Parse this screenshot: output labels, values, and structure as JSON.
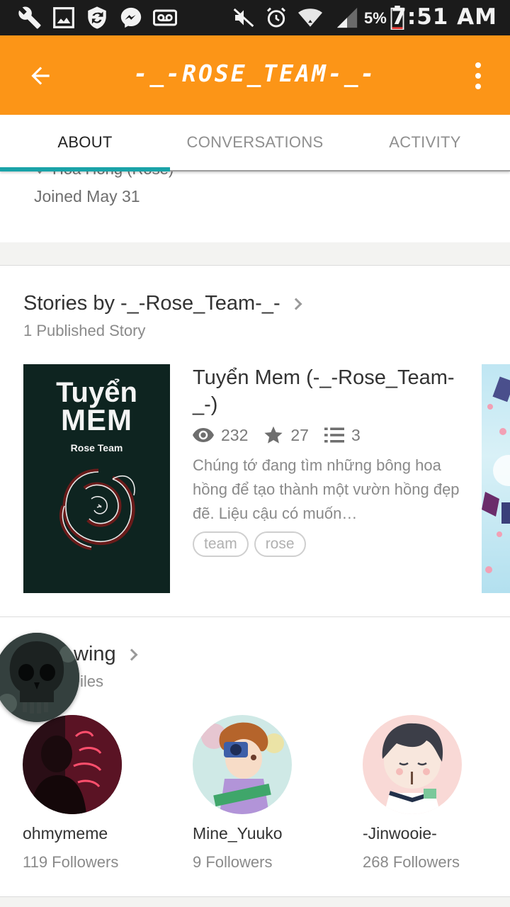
{
  "status_bar": {
    "battery": "5%",
    "time": "7:51 AM"
  },
  "app_bar": {
    "title": "-_-ROSE_TEAM-_-"
  },
  "tabs": [
    {
      "label": "ABOUT",
      "active": true
    },
    {
      "label": "CONVERSATIONS",
      "active": false
    },
    {
      "label": "ACTIVITY",
      "active": false
    }
  ],
  "about": {
    "location": "Hoa Hồng (Rose)",
    "joined": "Joined May 31"
  },
  "stories": {
    "title": "Stories by -_-Rose_Team-_-",
    "subtitle": "1 Published Story",
    "items": [
      {
        "cover_title_line1": "Tuyển",
        "cover_title_line2": "MEM",
        "cover_subtitle": "Rose Team",
        "title": "Tuyển Mem (-_-Rose_Team-_-)",
        "reads": "232",
        "votes": "27",
        "parts": "3",
        "description": "Chúng tớ đang tìm những bông hoa hồng để tạo thành một vườn hồng đẹp đẽ. Liệu cậu có muốn…",
        "tags": [
          "team",
          "rose"
        ]
      }
    ]
  },
  "following": {
    "title": "Following",
    "title_visible": "wing",
    "subtitle_visible": "iles",
    "users": [
      {
        "name": "ohmymeme",
        "followers": "119 Followers"
      },
      {
        "name": "Mine_Yuuko",
        "followers": "9 Followers"
      },
      {
        "name": "-Jinwooie-",
        "followers": "268 Followers"
      }
    ]
  },
  "colors": {
    "accent": "#fc9517",
    "tab_indicator": "#1aa3a8"
  }
}
